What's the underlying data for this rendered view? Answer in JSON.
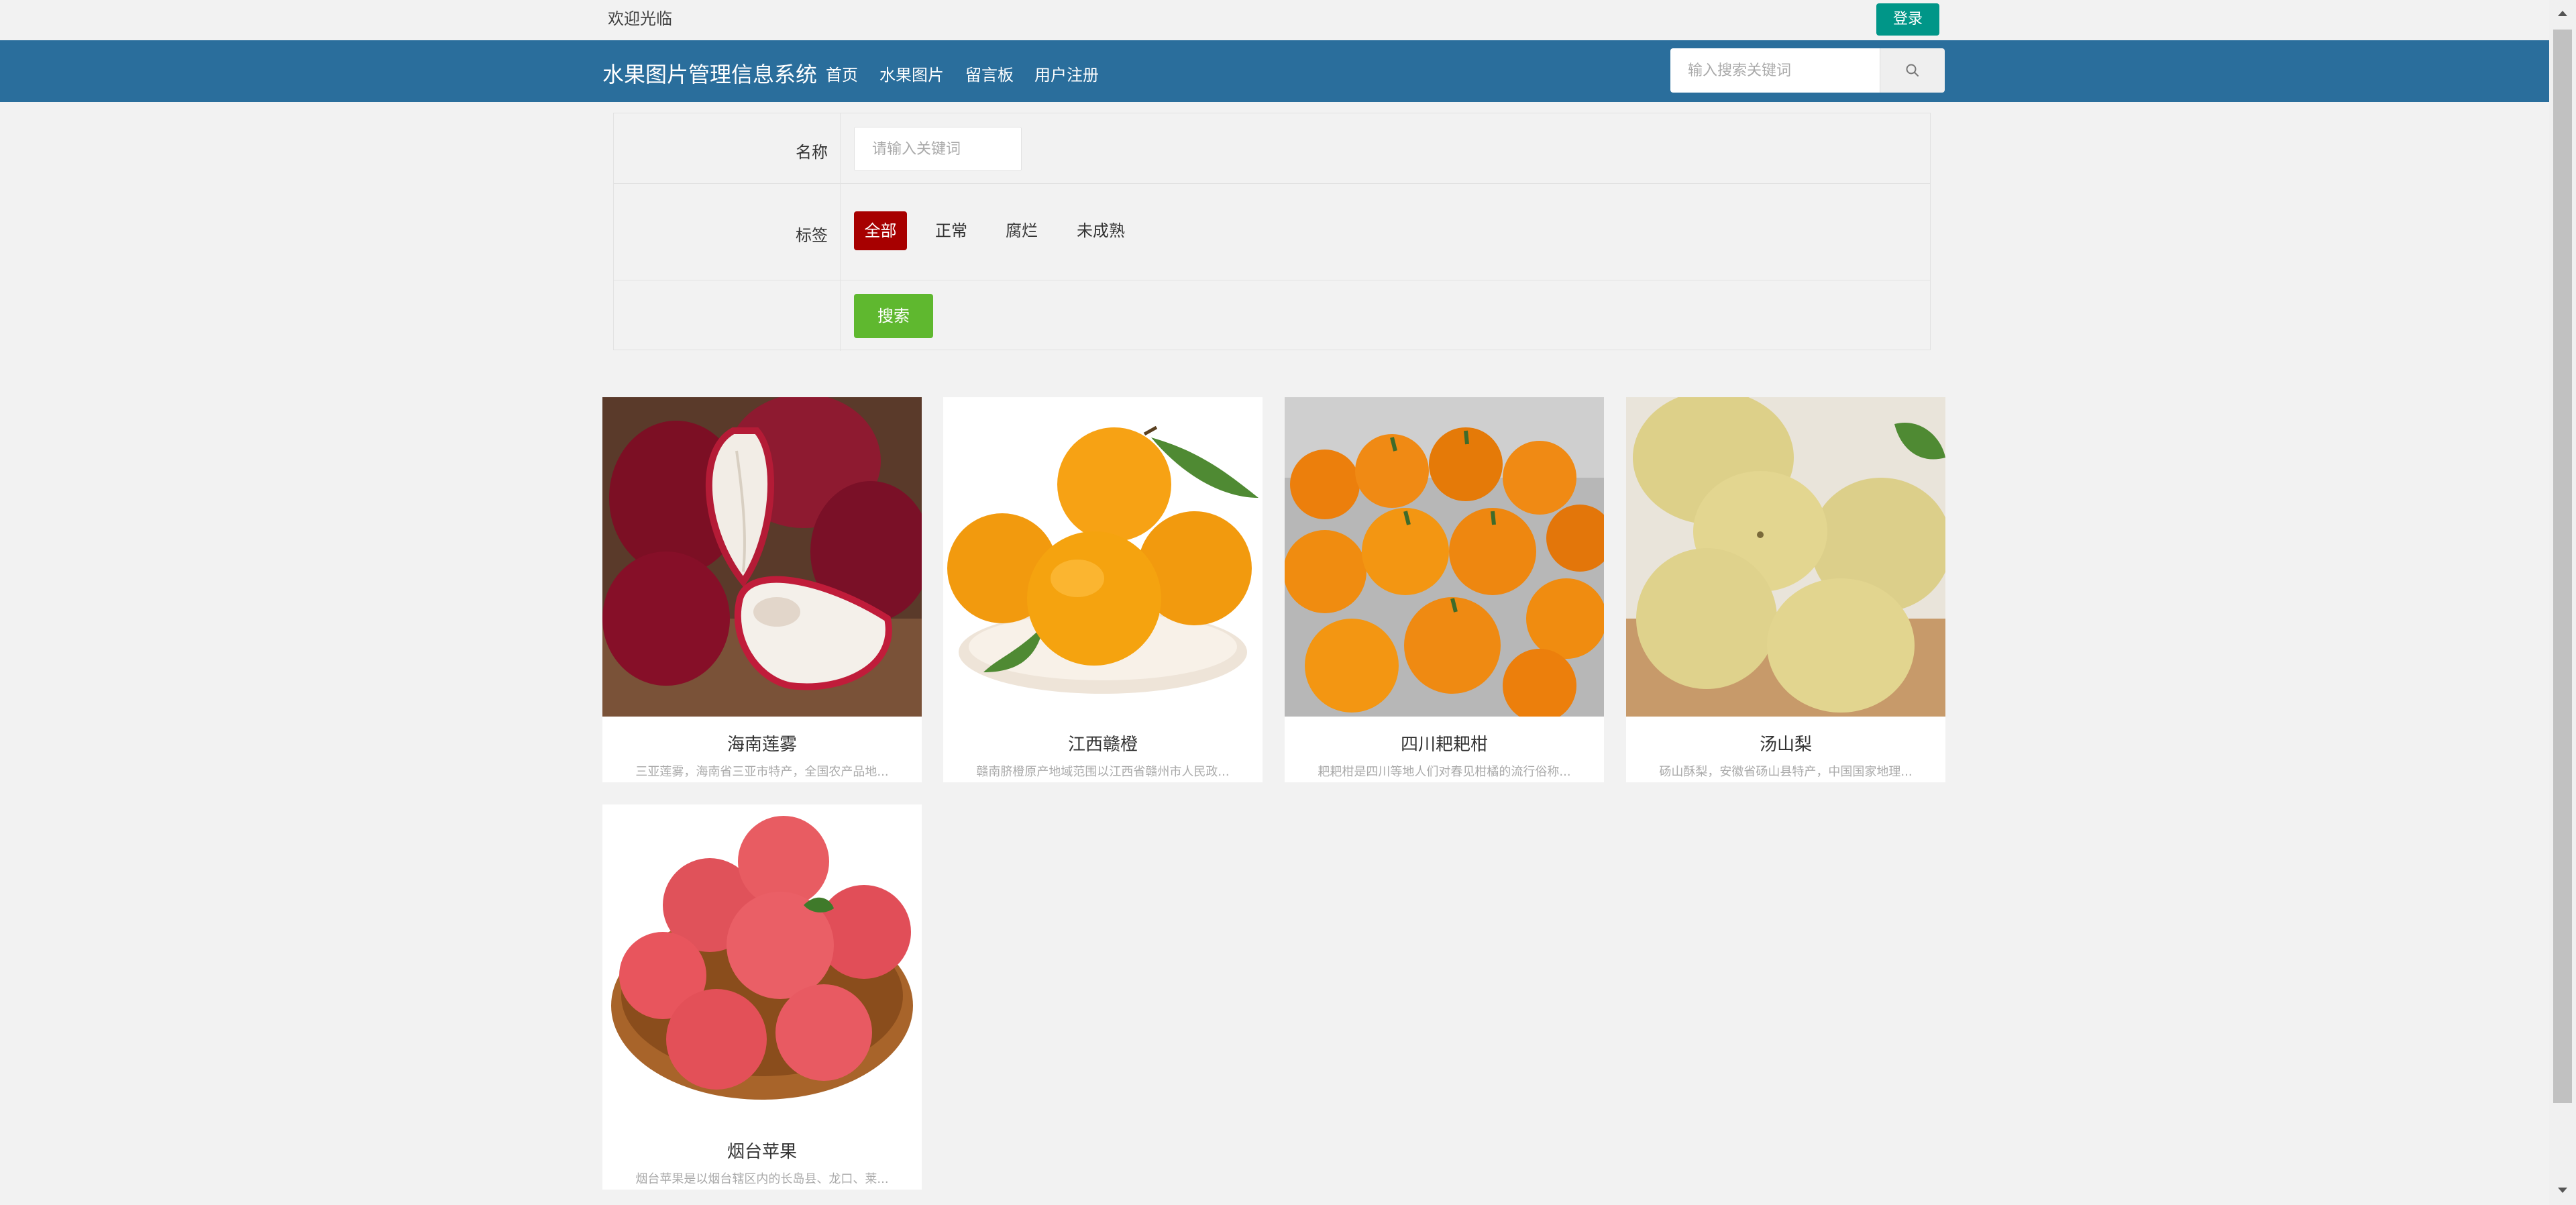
{
  "topbar": {
    "welcome": "欢迎光临",
    "login_label": "登录"
  },
  "navbar": {
    "brand": "水果图片管理信息系统",
    "items": [
      {
        "label": "首页"
      },
      {
        "label": "水果图片"
      },
      {
        "label": "留言板"
      },
      {
        "label": "用户注册"
      }
    ],
    "search_placeholder": "输入搜索关键词"
  },
  "filter": {
    "name_label": "名称",
    "name_placeholder": "请输入关键词",
    "tag_label": "标签",
    "tags": [
      {
        "label": "全部",
        "active": true
      },
      {
        "label": "正常"
      },
      {
        "label": "腐烂"
      },
      {
        "label": "未成熟"
      }
    ],
    "submit_label": "搜索"
  },
  "products": [
    {
      "title": "海南莲雾",
      "desc": "三亚莲雾，海南省三亚市特产，全国农产品地..."
    },
    {
      "title": "江西赣橙",
      "desc": "赣南脐橙原产地域范围以江西省赣州市人民政..."
    },
    {
      "title": "四川耙耙柑",
      "desc": "耙耙柑是四川等地人们对春见柑橘的流行俗称..."
    },
    {
      "title": "汤山梨",
      "desc": "砀山酥梨，安徽省砀山县特产，中国国家地理..."
    },
    {
      "title": "烟台苹果",
      "desc": "烟台苹果是以烟台辖区内的长岛县、龙口、莱..."
    }
  ],
  "colors": {
    "navbar": "#2a6e9c",
    "login": "#009688",
    "tag_active": "#a70000",
    "submit": "#5fb82f"
  },
  "icons": {
    "search": "search-icon"
  }
}
